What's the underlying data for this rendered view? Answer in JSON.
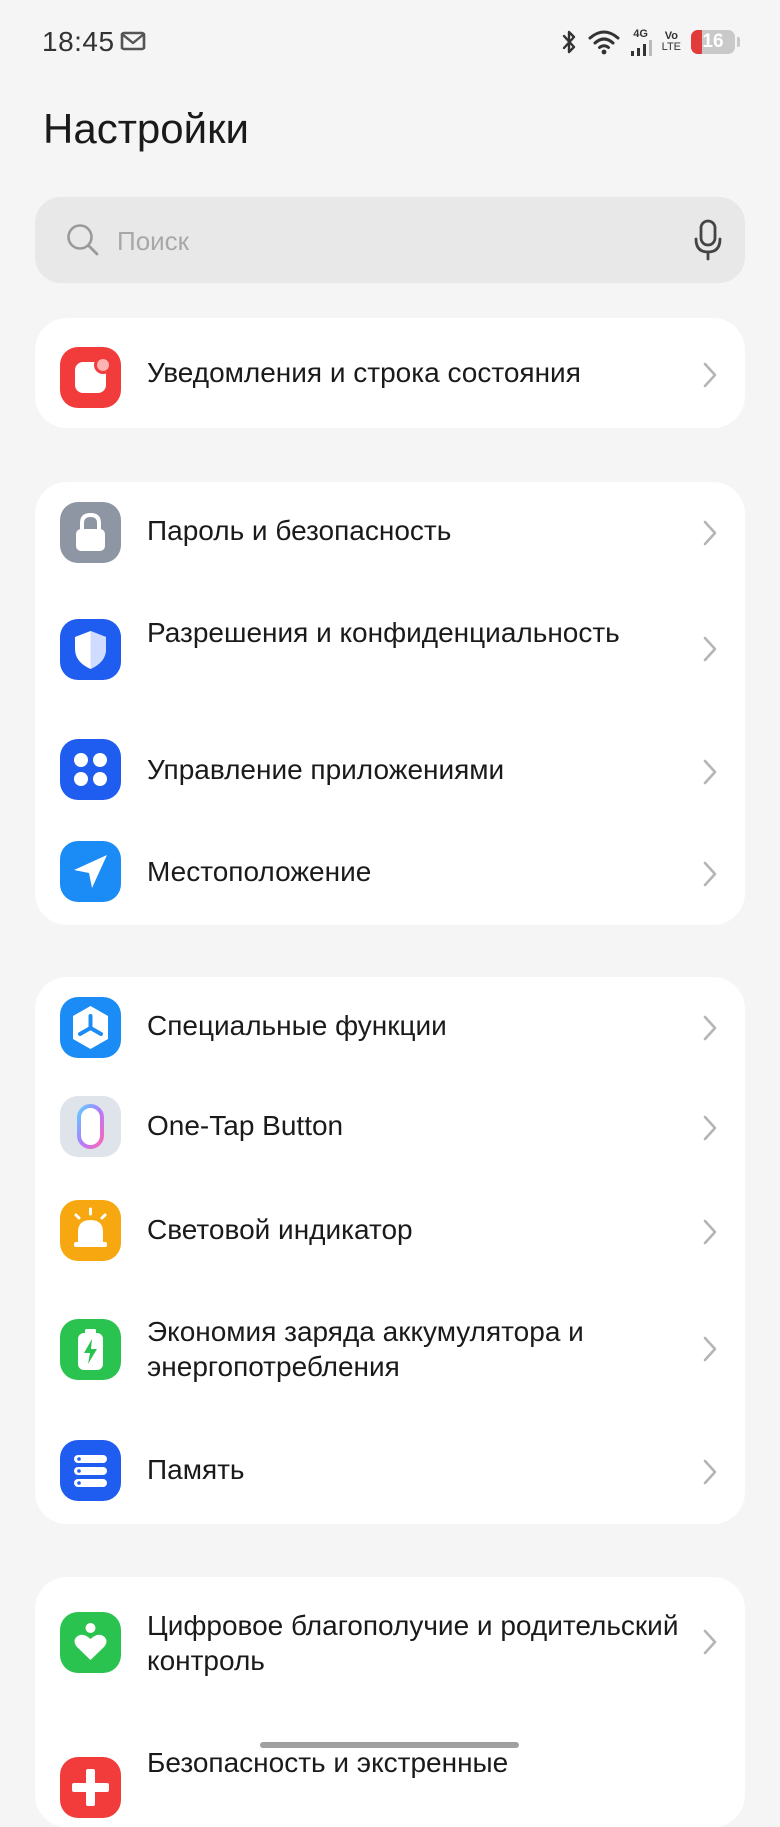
{
  "status_bar": {
    "time": "18:45",
    "network_type": "4G",
    "volte": [
      "Vo",
      "LTE"
    ],
    "battery_level": "16",
    "battery_fraction": 0.16,
    "battery_color": "#e23b3b"
  },
  "page": {
    "title": "Настройки"
  },
  "search": {
    "placeholder": "Поиск"
  },
  "groups": [
    [
      {
        "label": "Уведомления и строка состояния",
        "icon": "notifications-icon",
        "color": "#f23b3b"
      }
    ],
    [
      {
        "label": "Пароль и безопасность",
        "icon": "lock-icon",
        "color": "#8e95a3"
      },
      {
        "label": "Разрешения и конфиденциальность",
        "icon": "shield-icon",
        "color": "#1f5cf0"
      },
      {
        "label": "Управление приложениями",
        "icon": "apps-grid-icon",
        "color": "#1f5cf0"
      },
      {
        "label": "Местоположение",
        "icon": "location-arrow-icon",
        "color": "#1b8cf5"
      }
    ],
    [
      {
        "label": "Специальные функции",
        "icon": "accessibility-icon",
        "color": "#1b8cf5"
      },
      {
        "label": "One-Tap Button",
        "icon": "one-tap-button-icon",
        "color": "#dfe3ea"
      },
      {
        "label": "Световой индикатор",
        "icon": "indicator-light-icon",
        "color": "#f7a70f"
      },
      {
        "label": "Экономия заряда аккумулятора и энергопотребления",
        "icon": "battery-saver-icon",
        "color": "#2bc34f"
      },
      {
        "label": "Память",
        "icon": "storage-icon",
        "color": "#1f5cf0"
      }
    ],
    [
      {
        "label": "Цифровое благополучие и родительский контроль",
        "icon": "digital-wellbeing-icon",
        "color": "#2bc34f"
      },
      {
        "label": "Безопасность и экстренные",
        "icon": "emergency-icon",
        "color": "#f23b3b"
      }
    ]
  ]
}
